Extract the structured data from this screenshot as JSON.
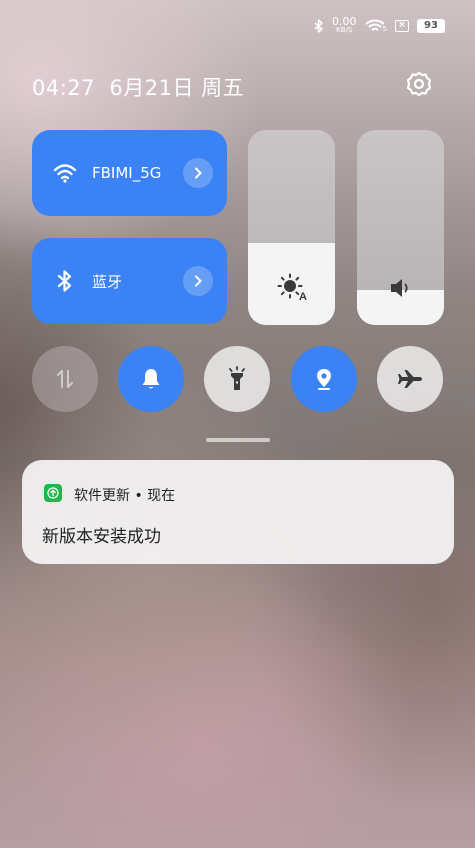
{
  "status_bar": {
    "net_speed_value": "0.00",
    "net_speed_unit": "KB/S",
    "wifi_generation": "5",
    "battery_level": "93",
    "icons": [
      "bluetooth-icon",
      "wifi-icon",
      "close-box-icon",
      "battery-icon"
    ]
  },
  "header": {
    "time": "04:27",
    "date": "6月21日",
    "weekday": "周五",
    "settings_icon": "gear-icon"
  },
  "tiles": {
    "wifi": {
      "label": "FBIMI_5G",
      "icon": "wifi-icon",
      "active": true
    },
    "bluetooth": {
      "label": "蓝牙",
      "icon": "bluetooth-icon",
      "active": true
    }
  },
  "sliders": {
    "brightness": {
      "icon": "auto-brightness-icon",
      "level": 0.42
    },
    "volume": {
      "icon": "speaker-icon",
      "level": 0.18
    }
  },
  "toggles": [
    {
      "name": "mobile-data",
      "icon": "data-arrows-icon",
      "state": "disabled"
    },
    {
      "name": "ring",
      "icon": "bell-icon",
      "state": "on"
    },
    {
      "name": "flashlight",
      "icon": "flashlight-icon",
      "state": "off"
    },
    {
      "name": "location",
      "icon": "location-pin-icon",
      "state": "on"
    },
    {
      "name": "airplane-mode",
      "icon": "airplane-icon",
      "state": "off"
    }
  ],
  "notification": {
    "app": "软件更新",
    "separator": "•",
    "time": "现在",
    "body": "新版本安装成功"
  },
  "colors": {
    "accent": "#3b83f5",
    "app_icon": "#22b54a"
  }
}
